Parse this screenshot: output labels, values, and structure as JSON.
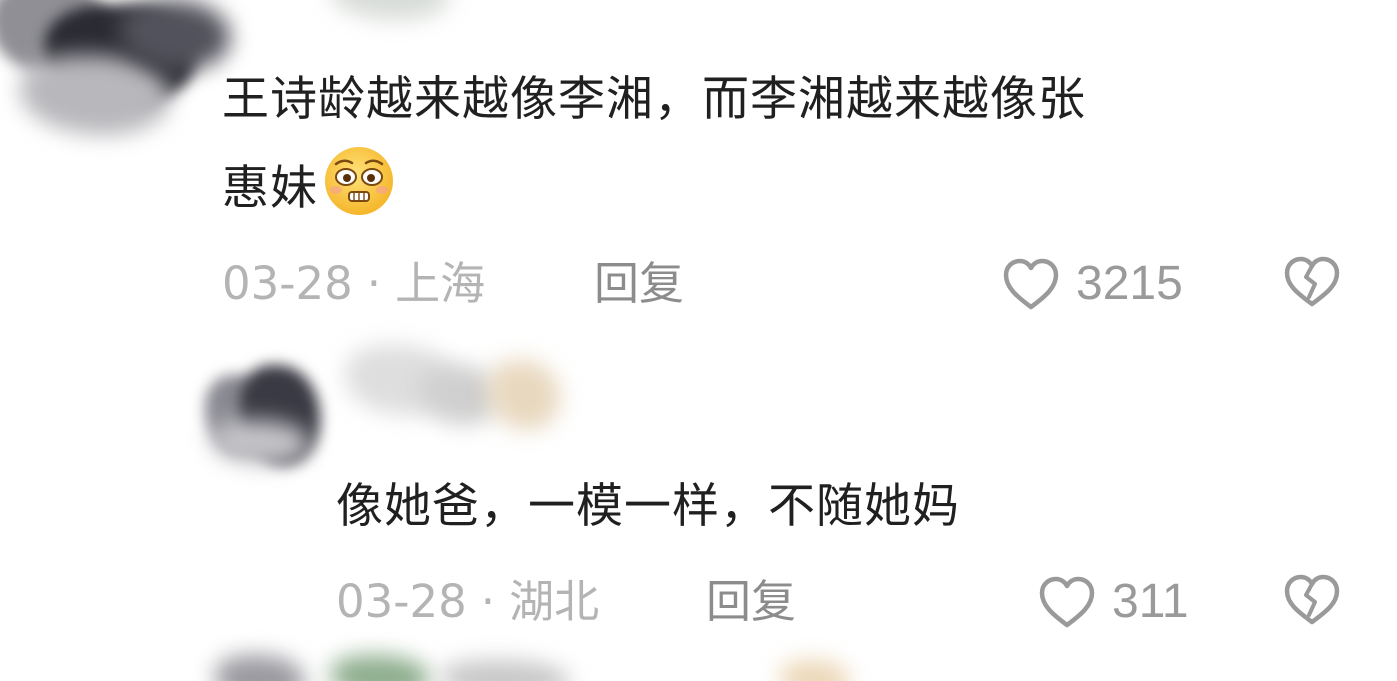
{
  "comments": [
    {
      "text_line1": "王诗龄越来越像李湘，而李湘越来越像张",
      "text_line2": "惠妹",
      "emoji": "worried-face-emoji",
      "date": "03-28",
      "separator": "·",
      "location": "上海",
      "reply_label": "回复",
      "like_count": "3215",
      "icons": {
        "like": "heart-outline-icon",
        "dislike": "broken-heart-icon"
      }
    },
    {
      "text_line1": "像她爸，一模一样，不随她妈",
      "date": "03-28",
      "separator": "·",
      "location": "湖北",
      "reply_label": "回复",
      "like_count": "311",
      "icons": {
        "like": "heart-outline-icon",
        "dislike": "broken-heart-icon"
      }
    }
  ],
  "colors": {
    "comment_text": "#202020",
    "meta_text": "#b4b4b4",
    "reply_text": "#8c8c8c",
    "icon_stroke": "#9a9a9a",
    "background": "#ffffff"
  }
}
